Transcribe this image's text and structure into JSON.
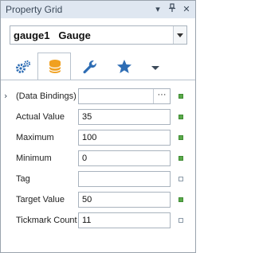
{
  "panel": {
    "title": "Property Grid",
    "title_icons": [
      "chevron-down-icon",
      "pin-icon",
      "close-icon"
    ]
  },
  "selector": {
    "value": "gauge1   Gauge"
  },
  "tabs": [
    {
      "icon": "gears-icon",
      "active": false
    },
    {
      "icon": "database-icon",
      "active": true
    },
    {
      "icon": "wrench-icon",
      "active": false
    },
    {
      "icon": "star-icon",
      "active": false
    },
    {
      "icon": "chevron-down-icon",
      "active": false
    }
  ],
  "properties": [
    {
      "label": "(Data Bindings)",
      "value": "",
      "expandable": true,
      "button": "···",
      "modified": true
    },
    {
      "label": "Actual Value",
      "value": "35",
      "modified": true
    },
    {
      "label": "Maximum",
      "value": "100",
      "modified": true
    },
    {
      "label": "Minimum",
      "value": "0",
      "modified": true
    },
    {
      "label": "Tag",
      "value": "",
      "modified": false
    },
    {
      "label": "Target Value",
      "value": "50",
      "modified": true
    },
    {
      "label": "Tickmark Count",
      "value": "11",
      "modified": false
    }
  ],
  "colors": {
    "title_bar": "#dfe7f1",
    "accent_blue": "#2e6db4",
    "db_orange": "#f0a020",
    "marker_green": "#5aaa4a"
  }
}
